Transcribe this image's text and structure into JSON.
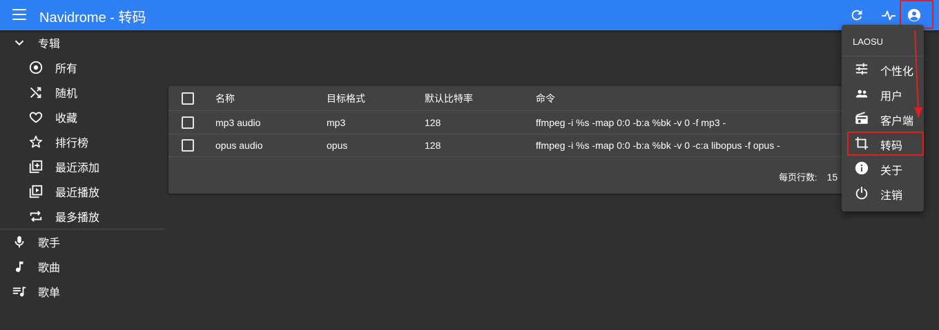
{
  "appbar": {
    "title": "Navidrome - 转码",
    "color": "#2f7ff5",
    "icons": [
      "menu-icon",
      "refresh-icon",
      "activity-icon",
      "account-circle-icon"
    ]
  },
  "sidebar": {
    "albums": {
      "label": "专辑",
      "icon": "chevron-down-icon"
    },
    "album_items": [
      {
        "label": "所有",
        "icon": "album-icon"
      },
      {
        "label": "随机",
        "icon": "shuffle-icon"
      },
      {
        "label": "收藏",
        "icon": "heart-icon"
      },
      {
        "label": "排行榜",
        "icon": "star-icon"
      },
      {
        "label": "最近添加",
        "icon": "library-add-icon"
      },
      {
        "label": "最近播放",
        "icon": "video-library-icon"
      },
      {
        "label": "最多播放",
        "icon": "repeat-icon"
      }
    ],
    "top_items": [
      {
        "label": "歌手",
        "icon": "mic-icon"
      },
      {
        "label": "歌曲",
        "icon": "music-note-icon"
      },
      {
        "label": "歌单",
        "icon": "queue-music-icon"
      }
    ]
  },
  "table": {
    "headers": [
      "名称",
      "目标格式",
      "默认比特率",
      "命令"
    ],
    "rows": [
      {
        "name": "mp3 audio",
        "format": "mp3",
        "bitrate": "128",
        "command": "ffmpeg -i %s -map 0:0 -b:a %bk -v 0 -f mp3 -"
      },
      {
        "name": "opus audio",
        "format": "opus",
        "bitrate": "128",
        "command": "ffmpeg -i %s -map 0:0 -b:a %bk -v 0 -c:a libopus -f opus -"
      }
    ],
    "pager_label": "每页行数:",
    "pager_value": "15"
  },
  "user_menu": {
    "username": "LAOSU",
    "items": [
      {
        "label": "个性化",
        "icon": "tune-icon"
      },
      {
        "label": "用户",
        "icon": "people-icon"
      },
      {
        "label": "客户端",
        "icon": "radio-icon"
      },
      {
        "label": "转码",
        "icon": "crop-icon"
      },
      {
        "label": "关于",
        "icon": "info-icon"
      },
      {
        "label": "注销",
        "icon": "power-icon"
      }
    ]
  },
  "annotation_color": "#e02020"
}
